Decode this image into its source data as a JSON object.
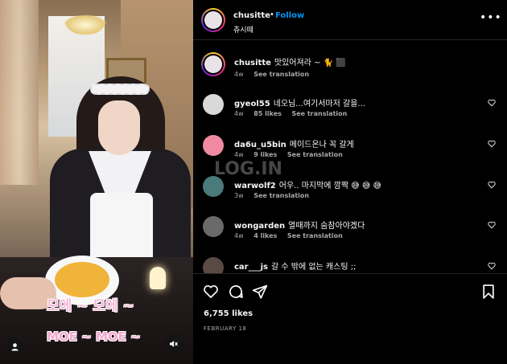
{
  "media": {
    "caption_ko": "모에 ~ 모에 ~",
    "caption_en": "MOE ~ MOE ~"
  },
  "header": {
    "username": "chusitte",
    "dot": "•",
    "follow_label": "Follow",
    "subtitle": "츄시떼",
    "more_icon": "more-horizontal-icon"
  },
  "caption": {
    "username": "chusitte",
    "text": "맛있어져라 ~ 🐈 ⬛",
    "time": "4w",
    "translate": "See translation"
  },
  "comments": [
    {
      "username": "gyeol55",
      "text": "네오님...여기서마저 갈을...",
      "time": "4w",
      "likes": "85 likes",
      "translate": "See translation",
      "avatar_color": "#d9d9d9"
    },
    {
      "username": "da6u_u5bin",
      "text": "메이드온나 꼭 갈게",
      "time": "4w",
      "likes": "9 likes",
      "translate": "See translation",
      "avatar_color": "#f08aa0"
    },
    {
      "username": "warwolf2",
      "text": "어우.. 마지막에 깜짝 😅 😅 😅",
      "time": "3w",
      "likes": "",
      "translate": "See translation",
      "avatar_color": "#4a7a7a"
    },
    {
      "username": "wongarden",
      "text": "열때까지 숨참아야겠다",
      "time": "4w",
      "likes": "4 likes",
      "translate": "See translation",
      "avatar_color": "#6a6a6a"
    },
    {
      "username": "car___js",
      "text": "갈 수 밖에 없는 캐스팅 ;;",
      "time": "",
      "likes": "",
      "translate": "",
      "avatar_color": "#5a4a44"
    }
  ],
  "actions": {
    "likes": "6,755 likes",
    "date": "FEBRUARY 18"
  },
  "watermark": "LOG.IN"
}
